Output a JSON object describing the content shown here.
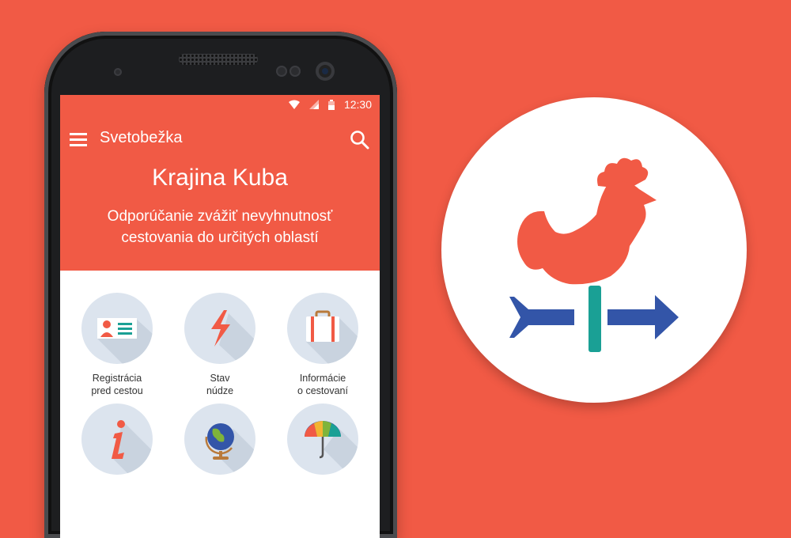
{
  "status": {
    "time": "12:30"
  },
  "toolbar": {
    "title": "Svetobežka",
    "menu_icon": "menu-icon",
    "search_icon": "search-icon"
  },
  "header": {
    "title": "Krajina Kuba",
    "advisory": "Odporúčanie zvážiť nevyhnutnosť cestovania do určitých oblastí"
  },
  "tiles": [
    {
      "label": "Registrácia\npred cestou",
      "icon": "id-card-icon"
    },
    {
      "label": "Stav\nnúdze",
      "icon": "lightning-icon"
    },
    {
      "label": "Informácie\no cestovaní",
      "icon": "suitcase-icon"
    },
    {
      "label": "",
      "icon": "info-icon"
    },
    {
      "label": "",
      "icon": "globe-icon"
    },
    {
      "label": "",
      "icon": "umbrella-icon"
    }
  ],
  "colors": {
    "brand": "#F15A45",
    "tile_bg": "#DCE4EE",
    "arrow_blue": "#3355A8",
    "pole_teal": "#1AA095"
  },
  "logo": {
    "icon": "weathervane-rooster-icon"
  }
}
